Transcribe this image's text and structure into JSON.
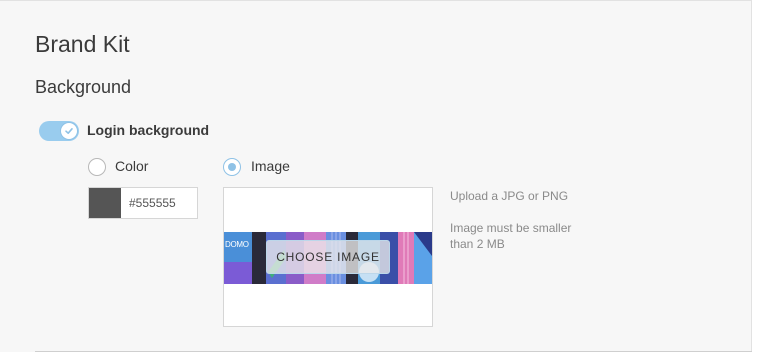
{
  "page": {
    "title": "Brand Kit"
  },
  "section": {
    "title": "Background"
  },
  "login_background": {
    "label": "Login background",
    "enabled": true,
    "options": [
      {
        "label": "Color",
        "selected": false
      },
      {
        "label": "Image",
        "selected": true
      }
    ],
    "color": {
      "value": "#555555"
    },
    "image": {
      "banner_text": "DOMO",
      "button_label": "CHOOSE IMAGE",
      "hint_format": "Upload a JPG or PNG",
      "hint_size": "Image must be smaller than 2 MB"
    }
  },
  "colors": {
    "accent": "#99ccee",
    "panel": "#f7f7f7",
    "swatch": "#555555"
  }
}
